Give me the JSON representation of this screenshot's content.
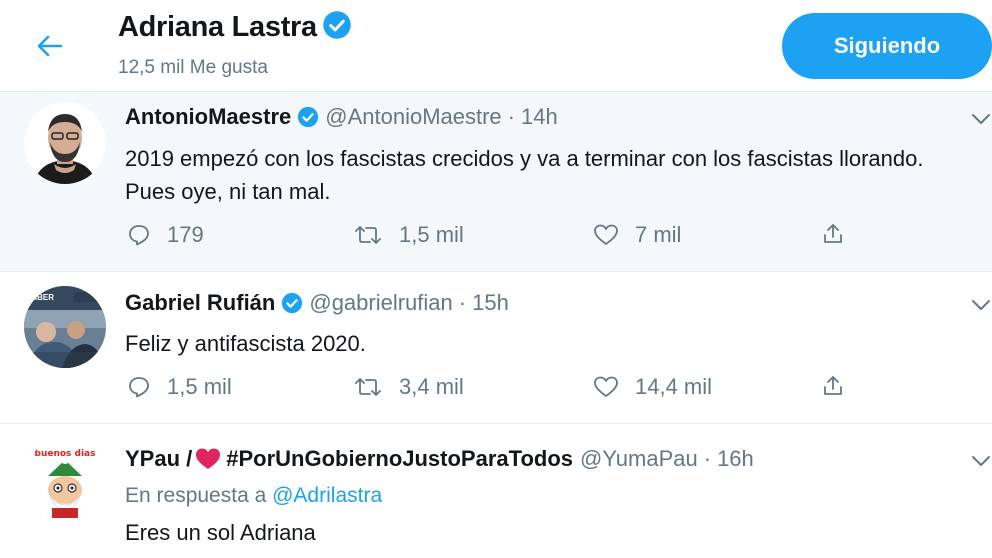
{
  "header": {
    "back_icon": "arrow-left-icon",
    "title": "Adriana Lastra",
    "verified_icon": "verified-badge-icon",
    "subtitle": "12,5 mil Me gusta",
    "follow_label": "Siguiendo"
  },
  "colors": {
    "accent": "#1da1f2",
    "text": "#14171a",
    "secondary": "#657786",
    "highlight_bg": "#f5f8fa",
    "divider": "#e6ecf0",
    "heart": "#e0245e"
  },
  "tweets": [
    {
      "name": "AntonioMaestre",
      "handle": "@AntonioMaestre",
      "sep": "·",
      "time": "14h",
      "text": "2019 empezó con los fascistas crecidos y va a terminar con los fascistas llorando. Pues oye, ni tan mal.",
      "reply_count": "179",
      "retweet_count": "1,5 mil",
      "like_count": "7 mil"
    },
    {
      "name": "Gabriel Rufián",
      "handle": "@gabrielrufian",
      "sep": "·",
      "time": "15h",
      "text": "Feliz y antifascista 2020.",
      "reply_count": "1,5 mil",
      "retweet_count": "3,4 mil",
      "like_count": "14,4 mil"
    },
    {
      "name_prefix": "YPau /",
      "name_suffix": "#PorUnGobiernoJustoParaTodos",
      "handle": "@YumaPau",
      "sep": "·",
      "time": "16h",
      "reply_label": "En respuesta a",
      "reply_mention": "@Adrilastra",
      "text": "Eres un sol Adriana",
      "avatar_text": "buenos dias"
    }
  ]
}
